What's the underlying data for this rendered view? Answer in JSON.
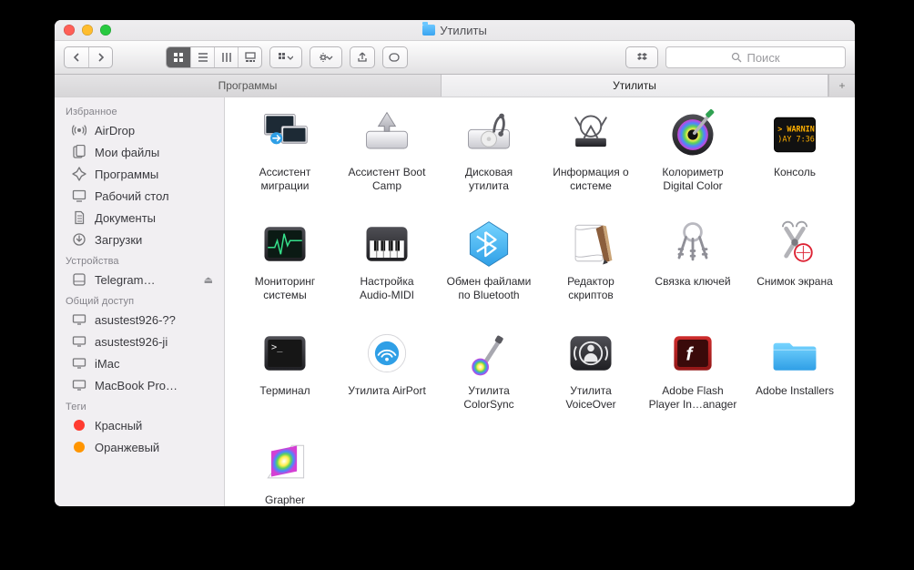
{
  "window": {
    "title": "Утилиты"
  },
  "tabs": {
    "items": [
      {
        "label": "Программы",
        "active": false
      },
      {
        "label": "Утилиты",
        "active": true
      }
    ]
  },
  "search": {
    "placeholder": "Поиск"
  },
  "sidebar": {
    "sections": [
      {
        "title": "Избранное",
        "items": [
          {
            "icon": "airdrop",
            "label": "AirDrop"
          },
          {
            "icon": "files",
            "label": "Мои файлы"
          },
          {
            "icon": "apps",
            "label": "Программы"
          },
          {
            "icon": "desktop",
            "label": "Рабочий стол"
          },
          {
            "icon": "docs",
            "label": "Документы"
          },
          {
            "icon": "downloads",
            "label": "Загрузки"
          }
        ]
      },
      {
        "title": "Устройства",
        "items": [
          {
            "icon": "disk",
            "label": "Telegram…",
            "eject": true
          }
        ]
      },
      {
        "title": "Общий доступ",
        "items": [
          {
            "icon": "screen",
            "label": "asustest926-??"
          },
          {
            "icon": "screen",
            "label": "asustest926-ji"
          },
          {
            "icon": "screen",
            "label": "iMac"
          },
          {
            "icon": "screen",
            "label": "MacBook Pro…"
          }
        ]
      },
      {
        "title": "Теги",
        "items": [
          {
            "icon": "tag",
            "label": "Красный",
            "color": "#ff3b30"
          },
          {
            "icon": "tag",
            "label": "Оранжевый",
            "color": "#ff9500"
          }
        ]
      }
    ]
  },
  "items": [
    {
      "id": "migration",
      "name": "Ассистент\nмиграции"
    },
    {
      "id": "bootcamp",
      "name": "Ассистент Boot\nCamp"
    },
    {
      "id": "diskutil",
      "name": "Дисковая\nутилита"
    },
    {
      "id": "sysinfo",
      "name": "Информация о\nсистеме"
    },
    {
      "id": "digitalcolor",
      "name": "Колориметр\nDigital Color"
    },
    {
      "id": "console",
      "name": "Консоль"
    },
    {
      "id": "activitymon",
      "name": "Мониторинг\nсистемы"
    },
    {
      "id": "audiomidi",
      "name": "Настройка\nAudio-MIDI"
    },
    {
      "id": "btexchange",
      "name": "Обмен файлами\nпо Bluetooth"
    },
    {
      "id": "scripteditor",
      "name": "Редактор\nскриптов"
    },
    {
      "id": "keychain",
      "name": "Связка ключей"
    },
    {
      "id": "screenshot",
      "name": "Снимок экрана"
    },
    {
      "id": "terminal",
      "name": "Терминал"
    },
    {
      "id": "airport",
      "name": "Утилита AirPort"
    },
    {
      "id": "colorsync",
      "name": "Утилита\nColorSync"
    },
    {
      "id": "voiceover",
      "name": "Утилита\nVoiceOver"
    },
    {
      "id": "flash",
      "name": "Adobe Flash\nPlayer In…anager"
    },
    {
      "id": "adobeinst",
      "name": "Adobe Installers"
    },
    {
      "id": "grapher",
      "name": "Grapher"
    }
  ]
}
